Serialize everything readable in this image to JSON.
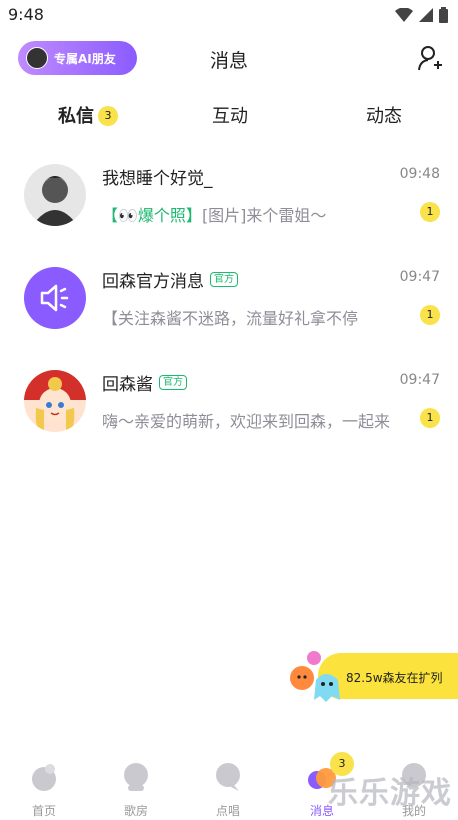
{
  "status_bar": {
    "time": "9:48"
  },
  "header": {
    "ai_button_label": "专属AI朋友",
    "title": "消息"
  },
  "tabs": [
    {
      "label": "私信",
      "badge": "3"
    },
    {
      "label": "互动"
    },
    {
      "label": "动态"
    }
  ],
  "conversations": [
    {
      "name": "我想睡个好觉_",
      "time": "09:48",
      "preview_highlight": "【👀爆个照】",
      "preview": "[图片]来个雷姐～",
      "unread": "1"
    },
    {
      "name": "回森官方消息",
      "official_tag": "官方",
      "time": "09:47",
      "preview": "【关注森酱不迷路，流量好礼拿不停",
      "unread": "1"
    },
    {
      "name": "回森酱",
      "official_tag": "官方",
      "time": "09:47",
      "preview": "嗨～亲爱的萌新，欢迎来到回森，一起来",
      "unread": "1"
    }
  ],
  "float_banner": {
    "text": "82.5w森友在扩列"
  },
  "bottom_nav": [
    {
      "label": "首页"
    },
    {
      "label": "歌房"
    },
    {
      "label": "点唱"
    },
    {
      "label": "消息",
      "badge": "3"
    },
    {
      "label": "我的"
    }
  ],
  "watermark": {
    "text": "乐乐游戏"
  },
  "colors": {
    "accent": "#8a5cff",
    "badge": "#f9e24a",
    "official": "#1fb870"
  }
}
